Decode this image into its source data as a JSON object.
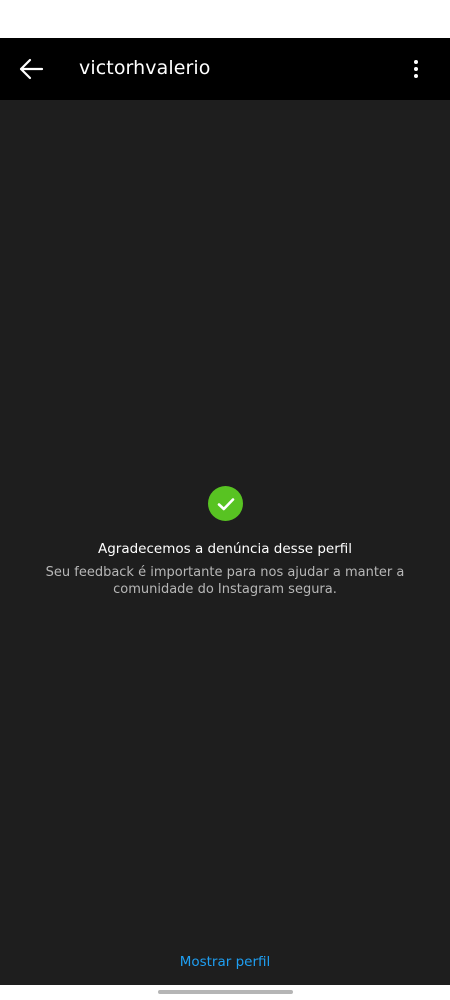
{
  "header": {
    "title": "victorhvalerio",
    "back_icon": "arrow-left-icon",
    "more_icon": "vertical-ellipsis-icon"
  },
  "confirmation": {
    "icon": "check-circle-icon",
    "heading": "Agradecemos a denúncia desse perfil",
    "description": "Seu feedback é importante para nos ajudar a manter a comunidade do Instagram segura."
  },
  "footer": {
    "show_profile_label": "Mostrar perfil"
  },
  "colors": {
    "header_bg": "#000000",
    "content_bg": "#1e1e1e",
    "success": "#58c322",
    "link": "#1f9ff2"
  }
}
